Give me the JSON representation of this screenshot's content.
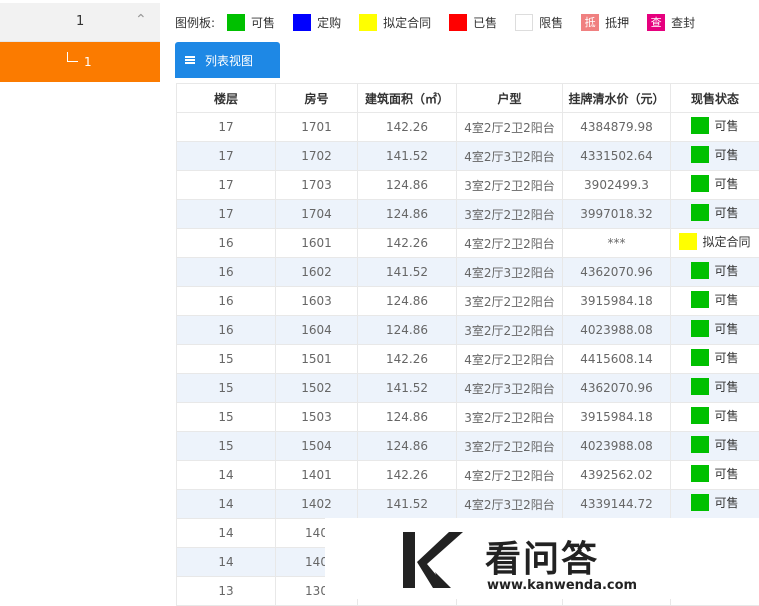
{
  "sidebar": {
    "header_label": "1",
    "selected_item": "1"
  },
  "legend": {
    "title": "图例板:",
    "items": [
      {
        "label": "可售",
        "color": "#00c000",
        "char": ""
      },
      {
        "label": "定购",
        "color": "#0000ff",
        "char": ""
      },
      {
        "label": "拟定合同",
        "color": "#ffff00",
        "char": ""
      },
      {
        "label": "已售",
        "color": "#ff0000",
        "char": ""
      },
      {
        "label": "限售",
        "color": "#ffffff",
        "char": ""
      },
      {
        "label": "抵押",
        "color": "#f08080",
        "char": "抵"
      },
      {
        "label": "查封",
        "color": "#e6007e",
        "char": "查"
      }
    ]
  },
  "tab": {
    "label": "列表视图"
  },
  "table": {
    "headers": [
      "楼层",
      "房号",
      "建筑面积（㎡）",
      "户型",
      "挂牌清水价（元）",
      "现售状态"
    ],
    "rows": [
      {
        "floor": "17",
        "room": "1701",
        "area": "142.26",
        "type": "4室2厅2卫2阳台",
        "price": "4384879.98",
        "status": "可售",
        "color": "#00c000"
      },
      {
        "floor": "17",
        "room": "1702",
        "area": "141.52",
        "type": "4室2厅3卫2阳台",
        "price": "4331502.64",
        "status": "可售",
        "color": "#00c000"
      },
      {
        "floor": "17",
        "room": "1703",
        "area": "124.86",
        "type": "3室2厅2卫2阳台",
        "price": "3902499.3",
        "status": "可售",
        "color": "#00c000"
      },
      {
        "floor": "17",
        "room": "1704",
        "area": "124.86",
        "type": "3室2厅2卫2阳台",
        "price": "3997018.32",
        "status": "可售",
        "color": "#00c000"
      },
      {
        "floor": "16",
        "room": "1601",
        "area": "142.26",
        "type": "4室2厅2卫2阳台",
        "price": "***",
        "status": "拟定合同",
        "color": "#ffff00"
      },
      {
        "floor": "16",
        "room": "1602",
        "area": "141.52",
        "type": "4室2厅3卫2阳台",
        "price": "4362070.96",
        "status": "可售",
        "color": "#00c000"
      },
      {
        "floor": "16",
        "room": "1603",
        "area": "124.86",
        "type": "3室2厅2卫2阳台",
        "price": "3915984.18",
        "status": "可售",
        "color": "#00c000"
      },
      {
        "floor": "16",
        "room": "1604",
        "area": "124.86",
        "type": "3室2厅2卫2阳台",
        "price": "4023988.08",
        "status": "可售",
        "color": "#00c000"
      },
      {
        "floor": "15",
        "room": "1501",
        "area": "142.26",
        "type": "4室2厅2卫2阳台",
        "price": "4415608.14",
        "status": "可售",
        "color": "#00c000"
      },
      {
        "floor": "15",
        "room": "1502",
        "area": "141.52",
        "type": "4室2厅3卫2阳台",
        "price": "4362070.96",
        "status": "可售",
        "color": "#00c000"
      },
      {
        "floor": "15",
        "room": "1503",
        "area": "124.86",
        "type": "3室2厅2卫2阳台",
        "price": "3915984.18",
        "status": "可售",
        "color": "#00c000"
      },
      {
        "floor": "15",
        "room": "1504",
        "area": "124.86",
        "type": "3室2厅2卫2阳台",
        "price": "4023988.08",
        "status": "可售",
        "color": "#00c000"
      },
      {
        "floor": "14",
        "room": "1401",
        "area": "142.26",
        "type": "4室2厅2卫2阳台",
        "price": "4392562.02",
        "status": "可售",
        "color": "#00c000"
      },
      {
        "floor": "14",
        "room": "1402",
        "area": "141.52",
        "type": "4室2厅3卫2阳台",
        "price": "4339144.72",
        "status": "可售",
        "color": "#00c000"
      },
      {
        "floor": "14",
        "room": "140",
        "area": "",
        "type": "",
        "price": "",
        "status": "",
        "color": ""
      },
      {
        "floor": "14",
        "room": "140",
        "area": "",
        "type": "",
        "price": "",
        "status": "",
        "color": ""
      },
      {
        "floor": "13",
        "room": "130",
        "area": "",
        "type": "",
        "price": "",
        "status": "",
        "color": ""
      }
    ]
  },
  "watermark": {
    "title": "看问答",
    "url": "www.kanwenda.com"
  }
}
